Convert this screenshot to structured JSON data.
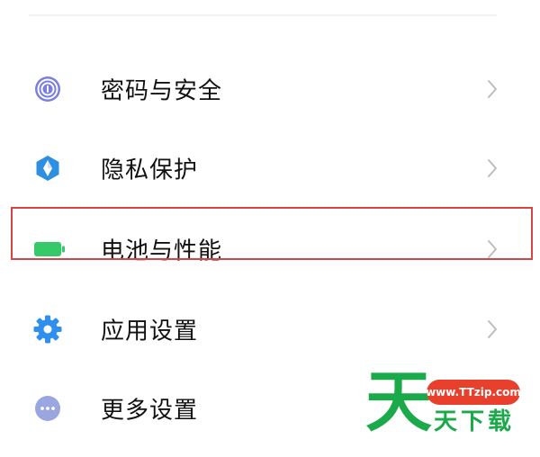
{
  "settings": {
    "items": [
      {
        "label": "密码与安全",
        "icon": "fingerprint-icon",
        "color": "#7a7ee0"
      },
      {
        "label": "隐私保护",
        "icon": "shield-icon",
        "color": "#2e8fe0"
      },
      {
        "label": "电池与性能",
        "icon": "battery-icon",
        "color": "#35c96a"
      },
      {
        "label": "应用设置",
        "icon": "gear-icon",
        "color": "#2f8ff0"
      },
      {
        "label": "更多设置",
        "icon": "more-icon",
        "color": "#9aa6e0"
      }
    ]
  },
  "watermark": {
    "big_char": "天",
    "url": "www.TTzip.com",
    "text": "天下载",
    "green": "#1aaa4a",
    "red": "#e8402d"
  },
  "highlight": {
    "color": "#d64545"
  }
}
